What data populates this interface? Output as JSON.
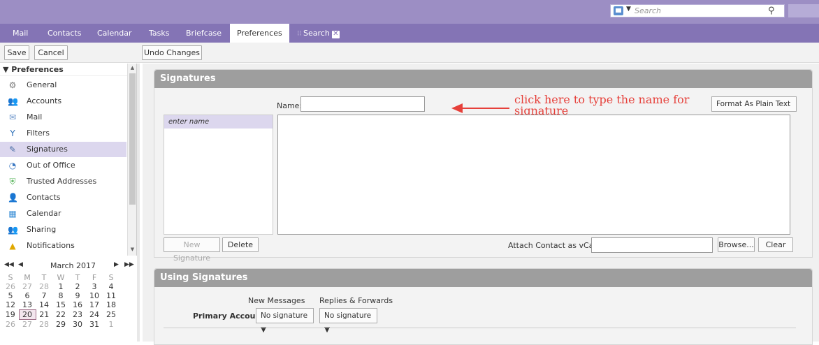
{
  "topbar": {
    "search_placeholder": "Search"
  },
  "tabs": [
    "Mail",
    "Contacts",
    "Calendar",
    "Tasks",
    "Briefcase",
    "Preferences",
    "Search"
  ],
  "toolbar": {
    "save_label": "Save",
    "cancel_label": "Cancel",
    "undo_label": "Undo Changes"
  },
  "sidebar": {
    "header": "Preferences",
    "items": [
      {
        "label": "General",
        "icon": "gear-icon"
      },
      {
        "label": "Accounts",
        "icon": "accounts-icon"
      },
      {
        "label": "Mail",
        "icon": "mail-icon"
      },
      {
        "label": "Filters",
        "icon": "filter-icon"
      },
      {
        "label": "Signatures",
        "icon": "signature-icon"
      },
      {
        "label": "Out of Office",
        "icon": "out-of-office-icon"
      },
      {
        "label": "Trusted Addresses",
        "icon": "shield-icon"
      },
      {
        "label": "Contacts",
        "icon": "contacts-icon"
      },
      {
        "label": "Calendar",
        "icon": "calendar-icon"
      },
      {
        "label": "Sharing",
        "icon": "sharing-icon"
      },
      {
        "label": "Notifications",
        "icon": "bell-icon"
      }
    ],
    "selected": "Signatures"
  },
  "calendar": {
    "month_label": "March 2017",
    "dow": [
      "S",
      "M",
      "T",
      "W",
      "T",
      "F",
      "S"
    ],
    "weeks": [
      [
        "26",
        "27",
        "28",
        "1",
        "2",
        "3",
        "4"
      ],
      [
        "5",
        "6",
        "7",
        "8",
        "9",
        "10",
        "11"
      ],
      [
        "12",
        "13",
        "14",
        "15",
        "16",
        "17",
        "18"
      ],
      [
        "19",
        "20",
        "21",
        "22",
        "23",
        "24",
        "25"
      ],
      [
        "26",
        "27",
        "28",
        "29",
        "30",
        "31",
        "1"
      ]
    ],
    "today": "20"
  },
  "signatures_panel": {
    "title": "Signatures",
    "name_label": "Name:",
    "name_value": "",
    "format_button": "Format As Plain Text",
    "list_item": "enter name",
    "new_signature": "New Signature",
    "delete": "Delete",
    "attach_label": "Attach Contact as vCard:",
    "browse": "Browse...",
    "clear": "Clear",
    "annotation": "click here to type the name for signature"
  },
  "using_panel": {
    "title": "Using Signatures",
    "col_new": "New Messages",
    "col_replies": "Replies & Forwards",
    "primary_label": "Primary Account:",
    "new_value": "No signature",
    "replies_value": "No signature"
  },
  "colors": {
    "topbar": "#9c8ec4",
    "tabbar": "#8474b5",
    "annotation": "#e6403a",
    "panel_header": "#9e9e9e",
    "selected_bg": "#dcd7ee"
  }
}
